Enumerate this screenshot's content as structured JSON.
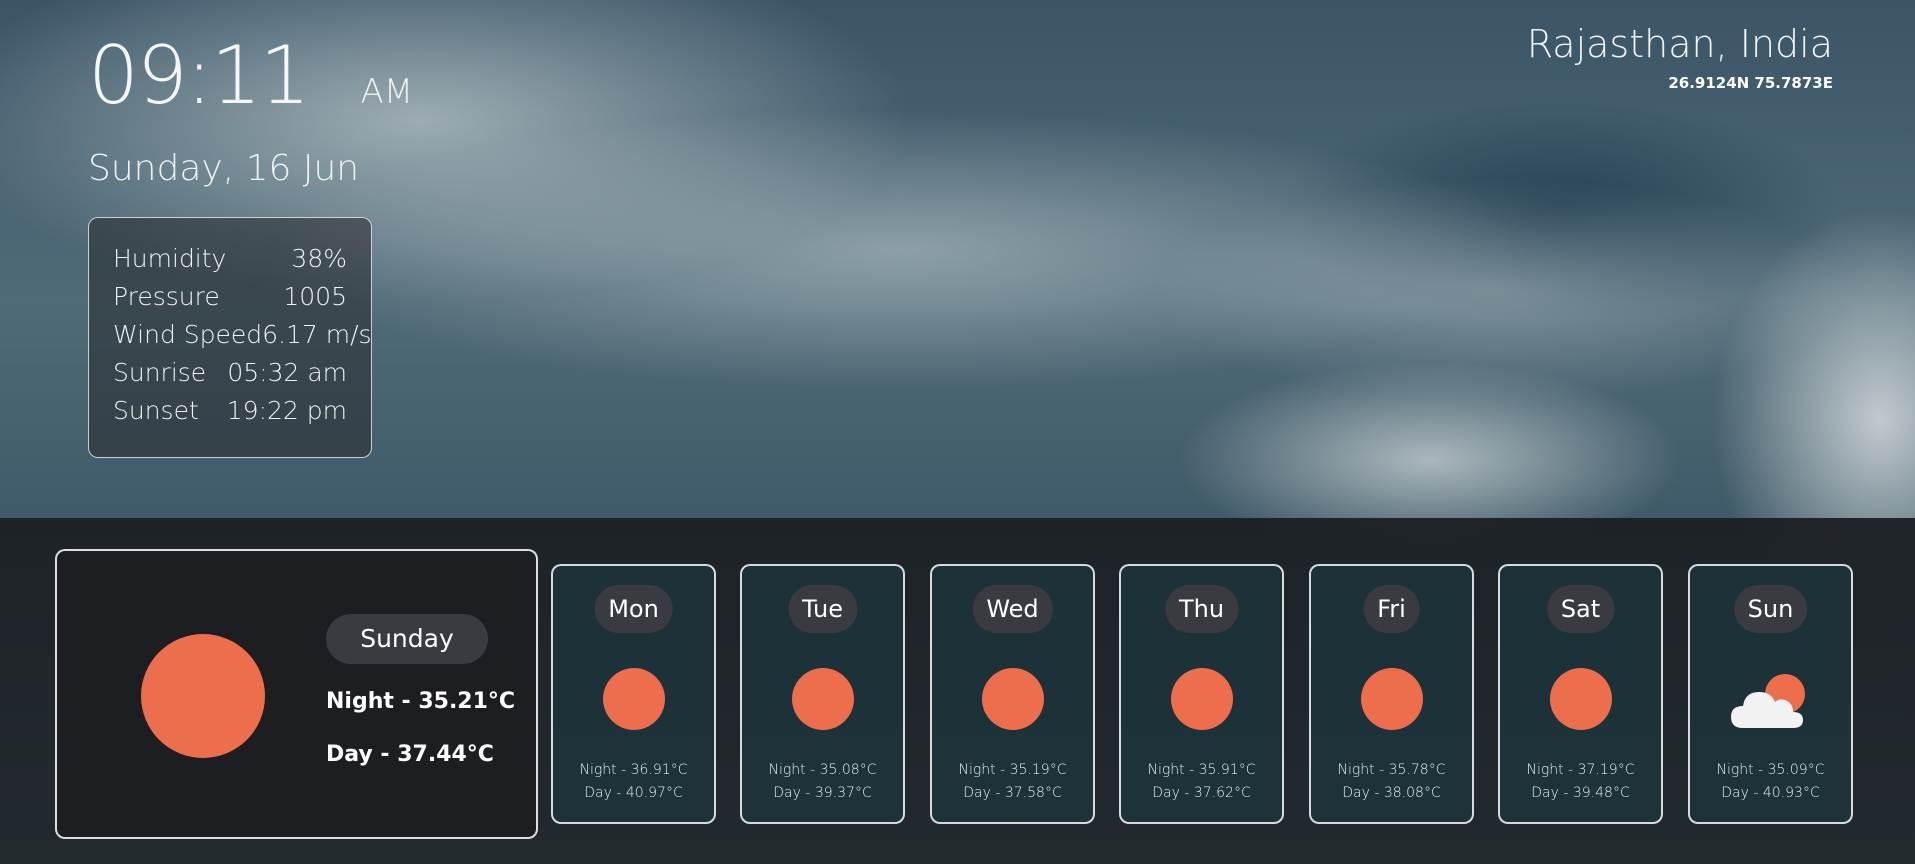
{
  "clock": {
    "time": "09:11",
    "ampm": "AM"
  },
  "date": "Sunday, 16 Jun",
  "details": [
    {
      "label": "Humidity",
      "value": "38%"
    },
    {
      "label": "Pressure",
      "value": "1005"
    },
    {
      "label": "Wind Speed",
      "value": "6.17 m/s"
    },
    {
      "label": "Sunrise",
      "value": "05:32 am"
    },
    {
      "label": "Sunset",
      "value": "19:22 pm"
    }
  ],
  "location": {
    "name": "Rajasthan, India",
    "coords": "26.9124N 75.7873E"
  },
  "today": {
    "day": "Sunday",
    "night": "Night - 35.21°C",
    "day_temp": "Day - 37.44°C",
    "icon": "sun-icon"
  },
  "forecast": [
    {
      "day": "Mon",
      "night": "Night - 36.91°C",
      "day_temp": "Day - 40.97°C",
      "icon": "sun-icon"
    },
    {
      "day": "Tue",
      "night": "Night - 35.08°C",
      "day_temp": "Day - 39.37°C",
      "icon": "sun-icon"
    },
    {
      "day": "Wed",
      "night": "Night - 35.19°C",
      "day_temp": "Day - 37.58°C",
      "icon": "sun-icon"
    },
    {
      "day": "Thu",
      "night": "Night - 35.91°C",
      "day_temp": "Day - 37.62°C",
      "icon": "sun-icon"
    },
    {
      "day": "Fri",
      "night": "Night - 35.78°C",
      "day_temp": "Day - 38.08°C",
      "icon": "sun-icon"
    },
    {
      "day": "Sat",
      "night": "Night - 37.19°C",
      "day_temp": "Day - 39.48°C",
      "icon": "sun-icon"
    },
    {
      "day": "Sun",
      "night": "Night - 35.09°C",
      "day_temp": "Day - 40.93°C",
      "icon": "partly-cloudy-icon"
    }
  ],
  "colors": {
    "sun": "#ec6e4d",
    "pill": "#3a3b40",
    "card_border": "#ffffff"
  }
}
